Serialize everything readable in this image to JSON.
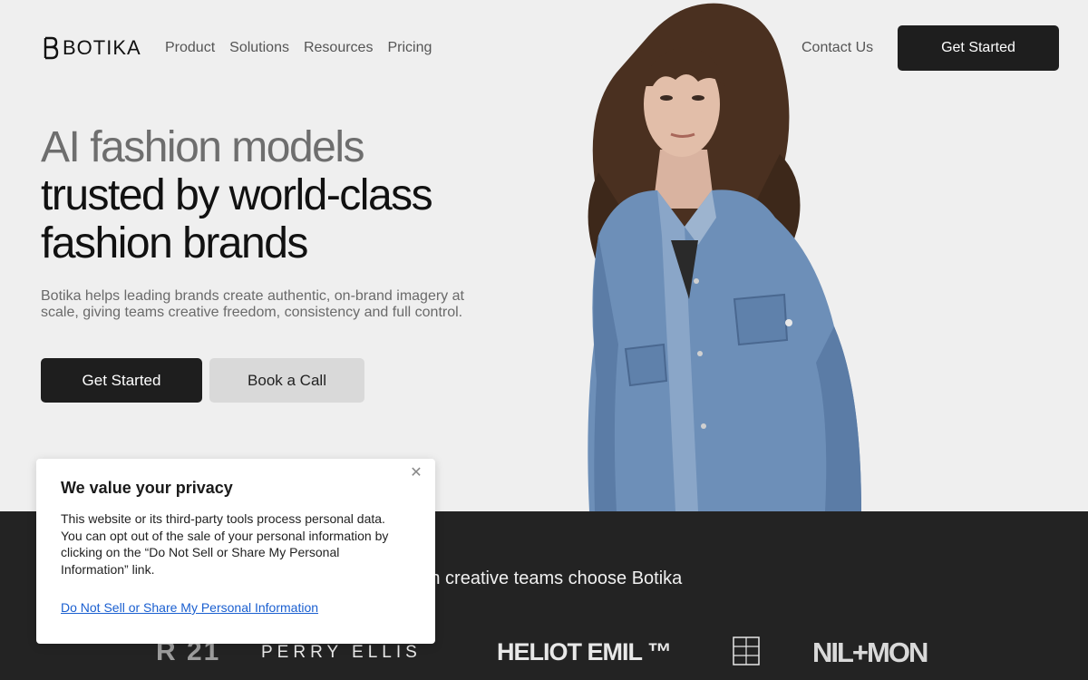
{
  "header": {
    "logo_text": "BOTIKA",
    "nav": [
      "Product",
      "Solutions",
      "Resources",
      "Pricing"
    ],
    "contact_label": "Contact Us",
    "cta_label": "Get Started"
  },
  "hero": {
    "headline_line1": "AI fashion models",
    "headline_line2": "trusted by world-class",
    "headline_line3": "fashion brands",
    "subtext": "Botika helps leading brands create authentic, on-brand imagery at scale, giving teams creative freedom, consistency and full control.",
    "primary_cta": "Get Started",
    "secondary_cta": "Book a Call"
  },
  "band": {
    "title": "hion creative teams choose Botika",
    "brands": [
      "R 21",
      "PERRY ELLIS",
      "HELIOT EMIL ™",
      "LA RE DOU TE",
      "NIL+MON"
    ]
  },
  "cookie": {
    "title": "We value your privacy",
    "body": "This website or its third-party tools process personal data. You can opt out of the sale of your personal information by clicking on the “Do Not Sell or Share My Personal Information” link.",
    "link": "Do Not Sell or Share My Personal Information"
  },
  "colors": {
    "page_bg": "#efefef",
    "dark": "#1e1e1e",
    "band_bg": "#232323",
    "link": "#1a5fd0"
  }
}
